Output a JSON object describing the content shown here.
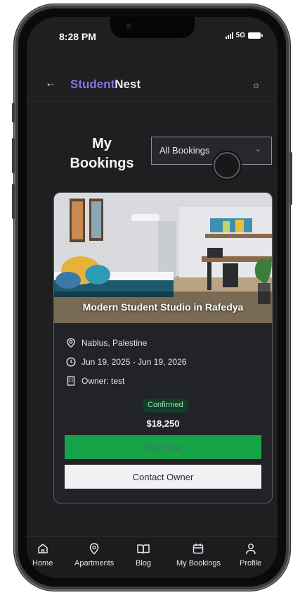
{
  "status_bar": {
    "time": "8:28 PM",
    "network": "5G"
  },
  "header": {
    "brand_primary": "Student",
    "brand_secondary": "Nest",
    "back_icon": "arrow-left-icon",
    "theme_icon": "sun-icon"
  },
  "page": {
    "title_line1": "My",
    "title_line2": "Bookings"
  },
  "filter": {
    "selected": "All Bookings"
  },
  "booking": {
    "title": "Modern Student Studio in Rafedya",
    "location": "Nablus, Palestine",
    "dates": "Jun 19, 2025 - Jun 19, 2026",
    "owner": "Owner: test",
    "status": "Confirmed",
    "price": "$18,250",
    "pay_label": "Pay Now",
    "contact_label": "Contact Owner"
  },
  "nav": {
    "items": [
      {
        "label": "Home",
        "icon": "home-icon"
      },
      {
        "label": "Apartments",
        "icon": "map-pin-icon"
      },
      {
        "label": "Blog",
        "icon": "book-icon"
      },
      {
        "label": "My Bookings",
        "icon": "calendar-icon"
      },
      {
        "label": "Profile",
        "icon": "user-icon"
      }
    ]
  },
  "colors": {
    "brand_accent": "#8b6fe0",
    "pay_button": "#16a34a",
    "status_badge_bg": "#143d27",
    "screen_bg": "#1e1f21"
  }
}
